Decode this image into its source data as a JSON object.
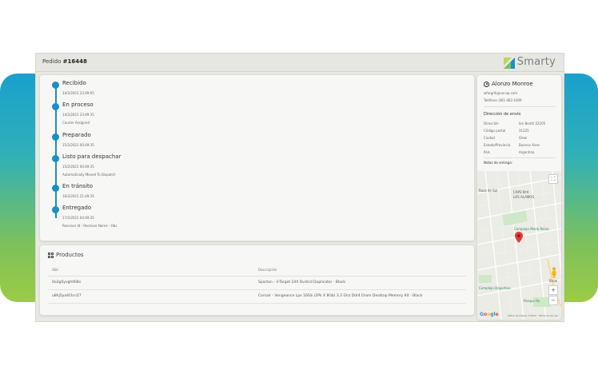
{
  "header": {
    "order_label": "Pedido",
    "order_number": "#16448",
    "brand": "Smarty"
  },
  "timeline": [
    {
      "title": "Recibido",
      "date": "14/2/2021 23:49:05",
      "note": ""
    },
    {
      "title": "En proceso",
      "date": "14/2/2021 23:49:35",
      "note": "Courier Assigned"
    },
    {
      "title": "Preparado",
      "date": "15/2/2021 00:49:35",
      "note": ""
    },
    {
      "title": "Listo para despachar",
      "date": "15/2/2021 00:49:35",
      "note": "Automatically Moved To Dispatch"
    },
    {
      "title": "En tránsito",
      "date": "16/2/2021 21:49:35",
      "note": ""
    },
    {
      "title": "Entregado",
      "date": "17/2/2021 04:49:35",
      "note": "Receiver Id - Receiver Name - Obs"
    }
  ],
  "products": {
    "title": "Productos",
    "columns": [
      "SKU",
      "Descripción"
    ],
    "rows": [
      {
        "sku": "0o2g0yvghl6l8n",
        "description": "Spartan - 3-Target 24X Dvd/cd Duplicator - Black"
      },
      {
        "sku": "u8hj5ya4t3cn27",
        "description": "Corsair - Vengeance Lpx 16Gb (2Pk X 8Gb) 3.2 Ghz Ddr4 Dram Desktop Memory Kit - Black"
      }
    ]
  },
  "customer": {
    "name": "Alonzo Monroe",
    "email": "wfargrlk@cw-op.com",
    "phone": "Teléfono: 801-462-1609"
  },
  "shipping": {
    "title": "Dirección de envío",
    "fields": [
      {
        "key": "Dirección",
        "value": "Ian Booth 22205"
      },
      {
        "key": "Código postal",
        "value": "31225"
      },
      {
        "key": "Ciudad",
        "value": "Glew"
      },
      {
        "key": "Estado/Provincia",
        "value": "Buenos Aires"
      },
      {
        "key": "País",
        "value": "Argentina"
      }
    ],
    "notes_label": "Notas de entrega:"
  },
  "map": {
    "labels": {
      "rosa": "Rosa de Sol",
      "caps": "CAPS Nº4",
      "alamos": "LOS ALAMOS",
      "complejo": "Complejo María Reina",
      "deportivo": "Complejo Deportivo",
      "parque": "Parque Ro",
      "brow": "Brow",
      "google": "Google",
      "data": "Datos de mapas ©2022",
      "terms": "Términos de uso"
    },
    "controls": {
      "zoom_in": "+",
      "zoom_out": "−",
      "fullscreen": "⛶"
    }
  },
  "colors": {
    "accent": "#1b8fc2",
    "pin": "#e53935",
    "pegman": "#f2b418"
  }
}
